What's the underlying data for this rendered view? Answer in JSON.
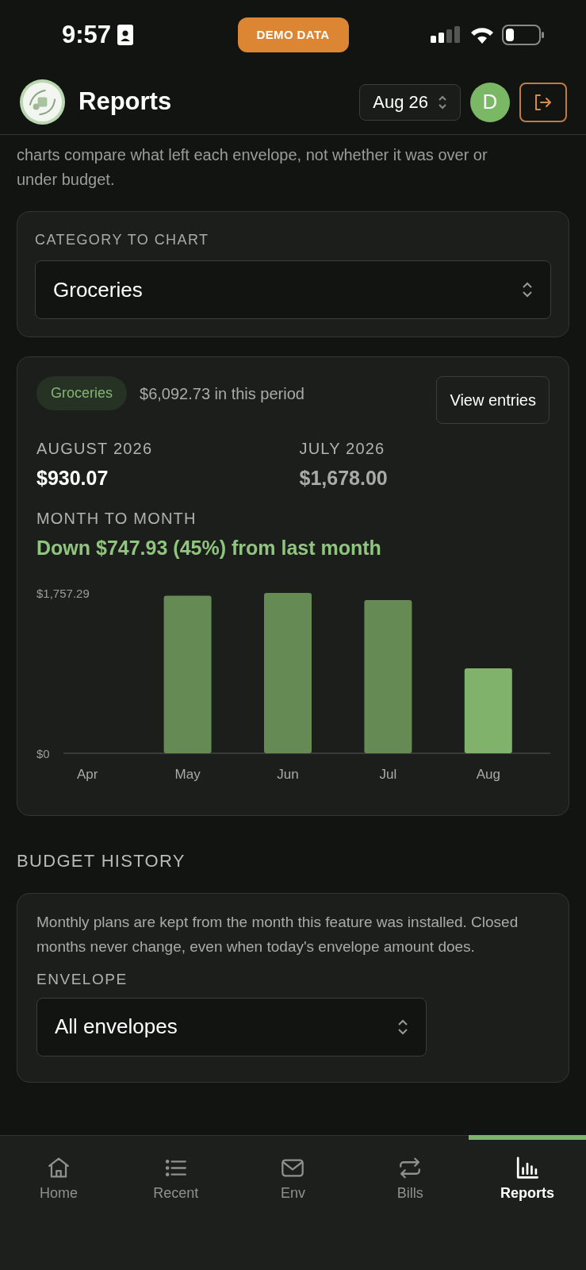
{
  "status_bar": {
    "time": "9:57",
    "badge": "DEMO DATA"
  },
  "header": {
    "title": "Reports",
    "period": "Aug 26",
    "avatar": "D"
  },
  "intro": "charts compare what left each envelope, not whether it was over or under budget.",
  "category_picker": {
    "label": "CATEGORY TO CHART",
    "value": "Groceries"
  },
  "summary": {
    "tag": "Groceries",
    "total": "$6,092.73 in this period",
    "button": "View entries",
    "current": {
      "label": "AUGUST 2026",
      "amount": "$930.07"
    },
    "previous": {
      "label": "JULY 2026",
      "amount": "$1,678.00"
    },
    "change_label": "MONTH TO MONTH",
    "change": "Down $747.93 (45%) from last month",
    "chart_data": {
      "type": "bar",
      "categories": [
        "Apr",
        "May",
        "Jun",
        "Jul",
        "Aug"
      ],
      "stacked": true,
      "series": [
        {
          "color": "#658a53",
          "values": [
            0,
            1727,
            1757.29,
            1678,
            null
          ]
        },
        {
          "color": "#80b26c",
          "values": [
            null,
            null,
            null,
            null,
            930.07
          ]
        }
      ],
      "ylim": [
        0,
        1757.29
      ],
      "yticks": [
        {
          "value": 0,
          "label": "$0"
        },
        {
          "value": 1757.29,
          "label": "$1,757.29"
        }
      ]
    }
  },
  "budget_history": {
    "heading": "BUDGET HISTORY",
    "text": "Monthly plans are kept from the month this feature was installed. Closed months never change, even when today's envelope amount does.",
    "envelope_label": "ENVELOPE",
    "envelope_value": "All envelopes"
  },
  "nav": [
    {
      "label": "Home",
      "kind": "home",
      "selected": false
    },
    {
      "label": "Recent",
      "kind": "list",
      "selected": false
    },
    {
      "label": "Env",
      "kind": "mail",
      "selected": false
    },
    {
      "label": "Bills",
      "kind": "repeat",
      "selected": false
    },
    {
      "label": "Reports",
      "kind": "chart",
      "selected": true
    }
  ]
}
